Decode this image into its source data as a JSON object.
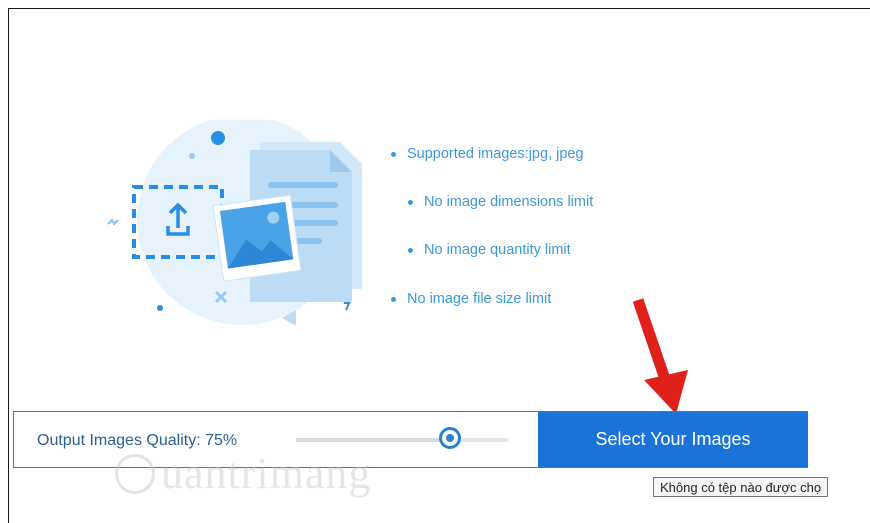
{
  "features": [
    {
      "text": "Supported images:jpg, jpeg"
    },
    {
      "text": "No image dimensions limit"
    },
    {
      "text": "No image quantity limit"
    },
    {
      "text": "No image file size limit"
    }
  ],
  "control_bar": {
    "quality_label": "Output Images Quality: 75%",
    "quality_value_percent": 75,
    "select_button_label": "Select Your Images"
  },
  "tooltip": {
    "text": "Không có tệp nào được chọ"
  },
  "watermark": {
    "text": "uantrimang"
  },
  "colors": {
    "accent": "#1a73d6",
    "feature_text": "#3a9ad9",
    "annotation_arrow": "#e0201b"
  },
  "icons": {
    "upload": "upload-icon",
    "image": "image-icon",
    "document": "document-icon"
  }
}
